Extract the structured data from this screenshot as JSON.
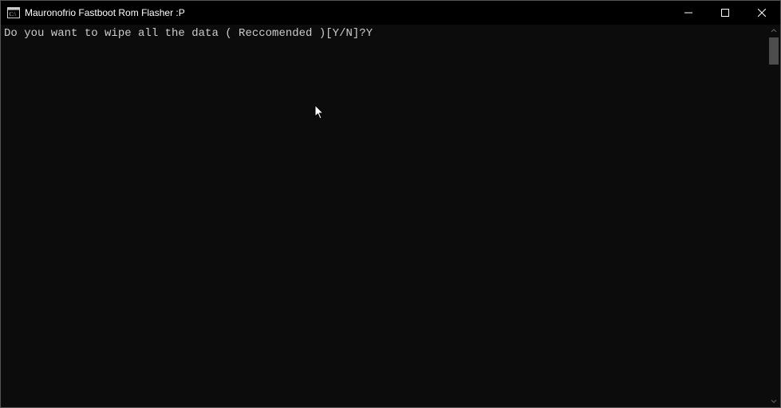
{
  "window": {
    "title": "Mauronofrio Fastboot Rom Flasher :P"
  },
  "console": {
    "prompt": "Do you want to wipe all the data ( Reccomended )[Y/N]?",
    "input": "Y"
  }
}
